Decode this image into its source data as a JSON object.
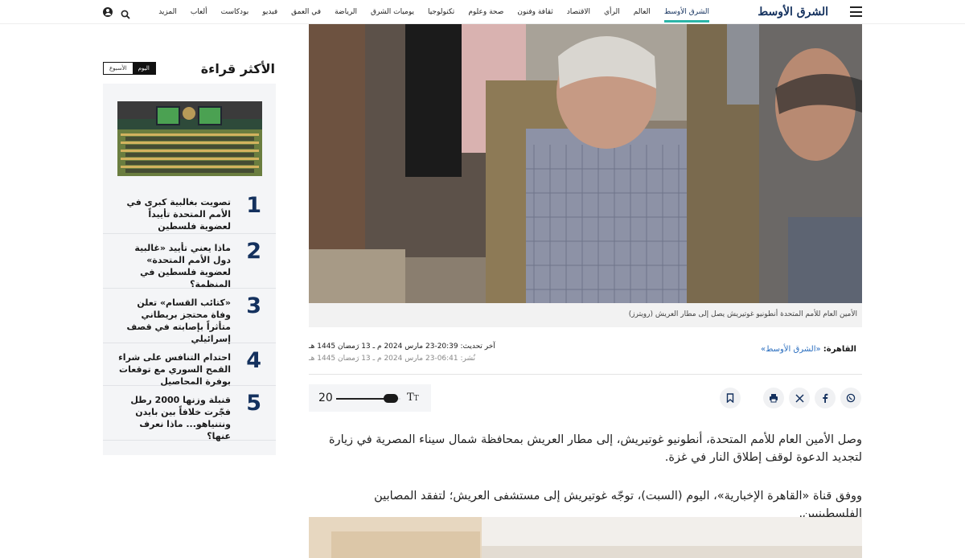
{
  "header": {
    "logo_text": "الشرق الأوسط",
    "nav": [
      "الشرق الأوسط",
      "العالم",
      "الرأي",
      "الاقتصاد",
      "ثقافة وفنون",
      "صحة وعلوم",
      "تكنولوجيا",
      "يوميات الشرق",
      "الرياضة",
      "في العمق",
      "فيديو",
      "بودكاست",
      "ألعاب",
      "المزيد"
    ],
    "active_nav": "الشرق الأوسط",
    "icons": [
      "menu-icon",
      "search-icon",
      "user-icon"
    ]
  },
  "sidebar": {
    "title": "الأكثر قراءة",
    "period_today": "اليوم",
    "period_week": "الأسبوع",
    "items": [
      {
        "rank": "1",
        "title": "تصويت بغالبية كبرى في الأمم المتحدة تأييداً لعضوية فلسطين"
      },
      {
        "rank": "2",
        "title": "ماذا يعني تأييد «غالبية دول الأمم المتحدة» لعضوية فلسطين في المنظمة؟"
      },
      {
        "rank": "3",
        "title": "«كتائب القسام» تعلن وفاة محتجز بريطاني متأثراً بإصابته في قصف إسرائيلي"
      },
      {
        "rank": "4",
        "title": "احتدام التنافس على شراء القمح السوري مع توقعات بوفرة المحاصيل"
      },
      {
        "rank": "5",
        "title": "قنبلة وزنها 2000 رطل فجّرت خلافاً بين بايدن ونتنياهو... ماذا نعرف عنها؟"
      }
    ]
  },
  "article": {
    "caption": "الأمين العام للأمم المتحدة أنطونيو غوتيريش يصل إلى مطار العريش (رويترز)",
    "location_label": "القاهرة:",
    "source": "«الشرق الأوسط»",
    "updated": "آخر تحديث: 20:39-23 مارس 2024 م ـ 13 رَمضان 1445 هـ",
    "published": "نُشر: 06:41-23 مارس 2024 م ـ 13 رَمضان 1445 هـ",
    "font_size": "20",
    "font_size_level": 0.85,
    "font_toggle_big": "T",
    "font_toggle_small": "T",
    "paragraph_1": "وصل الأمين العام للأمم المتحدة، أنطونيو غوتيريش، إلى مطار العريش بمحافظة شمال سيناء المصرية في زيارة لتجديد الدعوة لوقف إطلاق النار في غزة.",
    "paragraph_2": "ووفق قناة «القاهرة الإخبارية»، اليوم (السبت)، توجّه غوتيريش إلى مستشفى العريش؛ لتفقد المصابين الفلسطينيين.",
    "share_icons": [
      "whatsapp-icon",
      "facebook-icon",
      "x-icon",
      "print-icon",
      "bookmark-icon"
    ]
  }
}
